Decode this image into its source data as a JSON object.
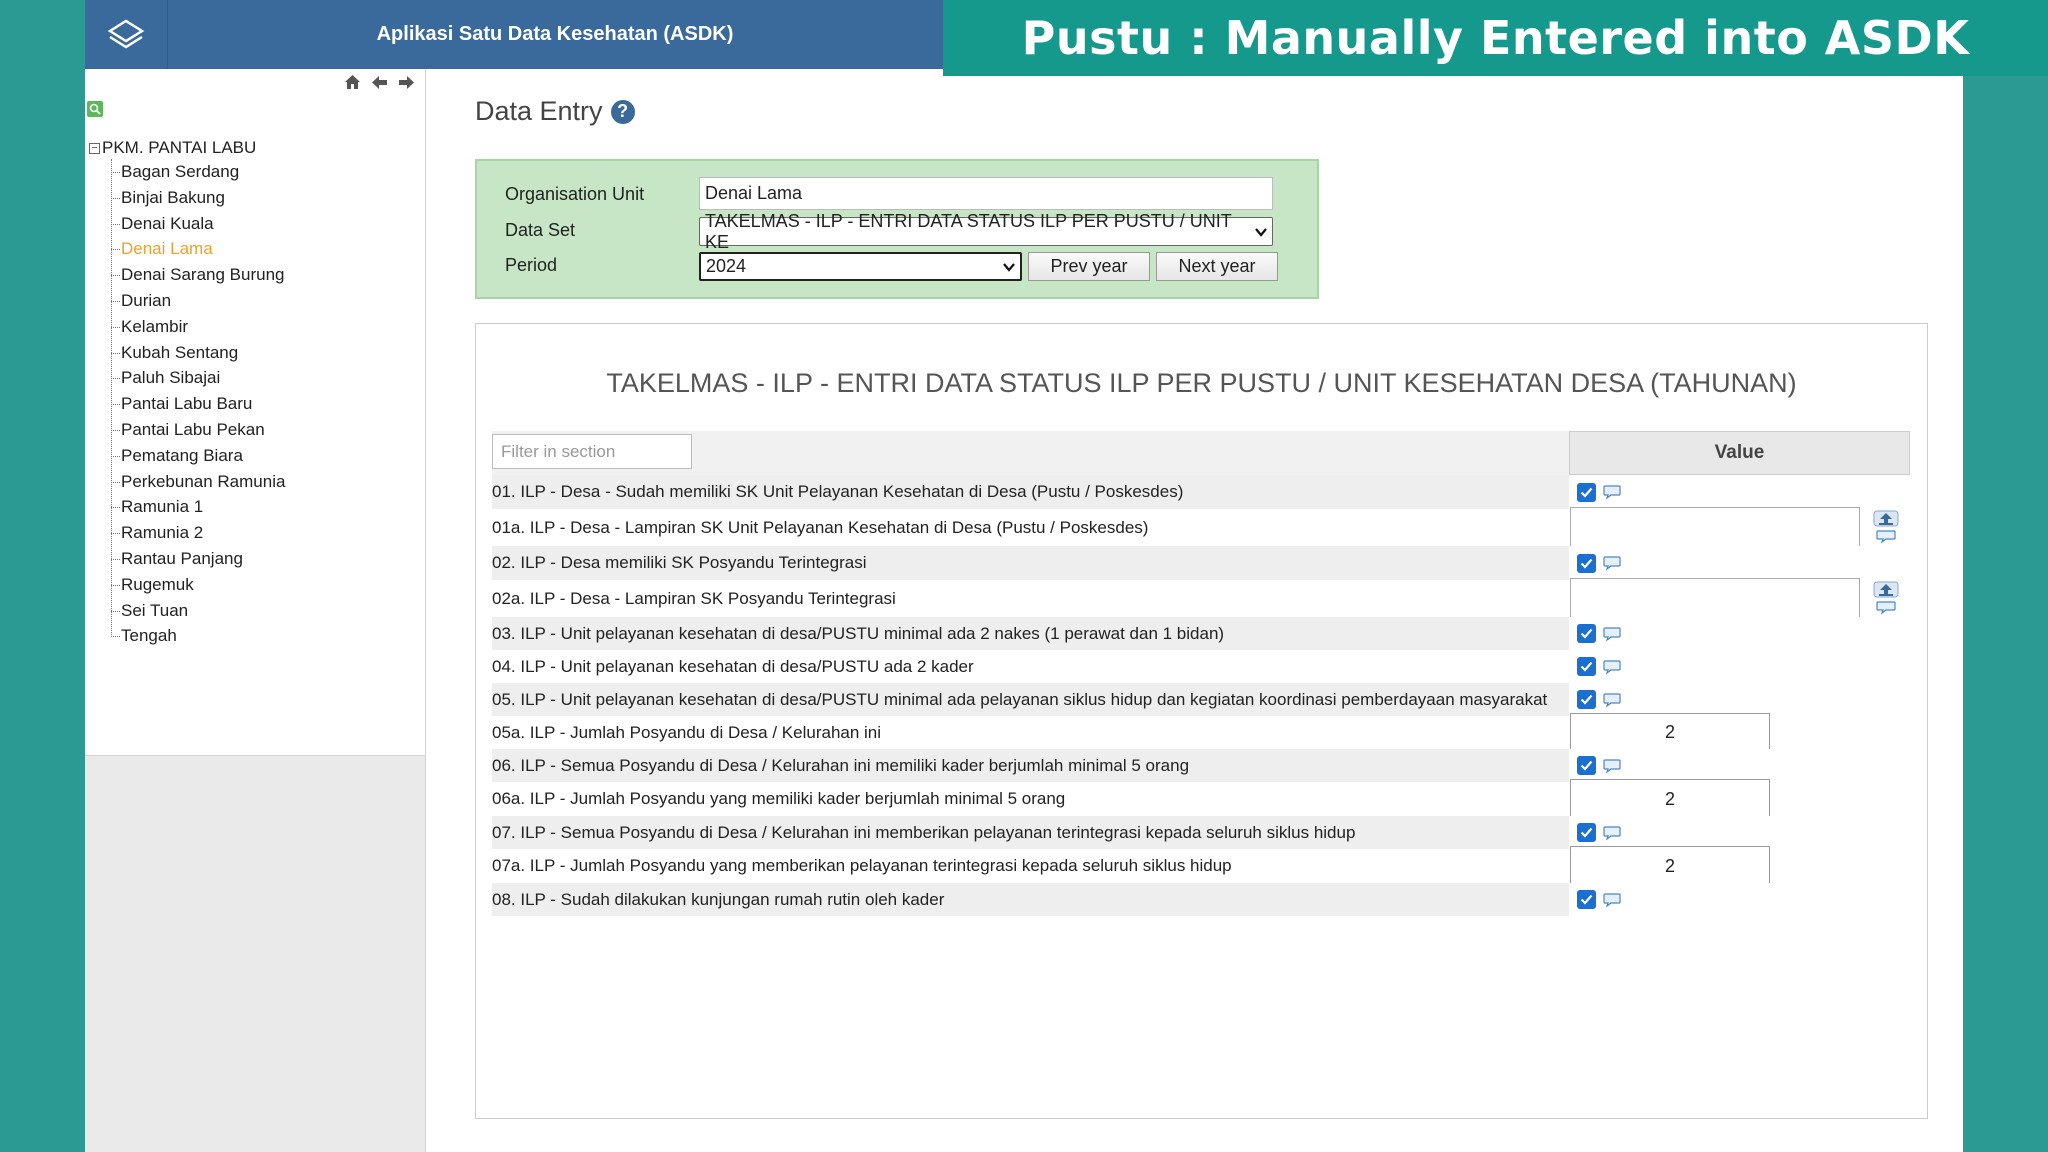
{
  "header": {
    "app_title": "Aplikasi Satu Data Kesehatan (ASDK)",
    "banner": "Pustu : Manually Entered into ASDK"
  },
  "sidebar": {
    "nav_icons": [
      "home-icon",
      "arrow-left-icon",
      "arrow-right-icon"
    ],
    "root": "PKM. PANTAI LABU",
    "items": [
      {
        "label": "Bagan Serdang"
      },
      {
        "label": "Binjai Bakung"
      },
      {
        "label": "Denai Kuala"
      },
      {
        "label": "Denai Lama",
        "selected": true
      },
      {
        "label": "Denai Sarang Burung"
      },
      {
        "label": "Durian"
      },
      {
        "label": "Kelambir"
      },
      {
        "label": "Kubah Sentang"
      },
      {
        "label": "Paluh Sibajai"
      },
      {
        "label": "Pantai Labu Baru"
      },
      {
        "label": "Pantai Labu Pekan"
      },
      {
        "label": "Pematang Biara"
      },
      {
        "label": "Perkebunan Ramunia"
      },
      {
        "label": "Ramunia 1"
      },
      {
        "label": "Ramunia 2"
      },
      {
        "label": "Rantau Panjang"
      },
      {
        "label": "Rugemuk"
      },
      {
        "label": "Sei Tuan"
      },
      {
        "label": "Tengah"
      }
    ]
  },
  "main": {
    "page_title": "Data Entry",
    "form": {
      "org_unit_label": "Organisation Unit",
      "org_unit_value": "Denai Lama",
      "data_set_label": "Data Set",
      "data_set_value": "TAKELMAS - ILP - ENTRI DATA STATUS ILP PER PUSTU / UNIT KE",
      "period_label": "Period",
      "period_value": "2024",
      "prev_year": "Prev year",
      "next_year": "Next year"
    },
    "section": {
      "title": "TAKELMAS - ILP - ENTRI DATA STATUS ILP PER PUSTU / UNIT KESEHATAN DESA (TAHUNAN)",
      "filter_placeholder": "Filter in section",
      "value_header": "Value",
      "rows": [
        {
          "label": "01. ILP - Desa - Sudah memiliki SK Unit Pelayanan Kesehatan di Desa (Pustu / Poskesdes)",
          "type": "checkbox",
          "checked": true
        },
        {
          "label": "01a. ILP - Desa - Lampiran SK Unit Pelayanan Kesehatan di Desa (Pustu / Poskesdes)",
          "type": "file"
        },
        {
          "label": "02. ILP - Desa memiliki SK Posyandu Terintegrasi",
          "type": "checkbox",
          "checked": true
        },
        {
          "label": "02a. ILP - Desa - Lampiran SK Posyandu Terintegrasi",
          "type": "file"
        },
        {
          "label": "03. ILP - Unit pelayanan kesehatan di desa/PUSTU minimal ada 2 nakes (1 perawat dan 1 bidan)",
          "type": "checkbox",
          "checked": true
        },
        {
          "label": "04. ILP - Unit pelayanan kesehatan di desa/PUSTU ada 2 kader",
          "type": "checkbox",
          "checked": true
        },
        {
          "label": "05. ILP - Unit pelayanan kesehatan di desa/PUSTU minimal ada pelayanan siklus hidup dan kegiatan koordinasi pemberdayaan masyarakat",
          "type": "checkbox",
          "checked": true
        },
        {
          "label": "05a. ILP - Jumlah Posyandu di Desa / Kelurahan ini",
          "type": "number",
          "value": "2"
        },
        {
          "label": "06. ILP - Semua Posyandu di Desa / Kelurahan ini memiliki kader berjumlah minimal 5 orang",
          "type": "checkbox",
          "checked": true
        },
        {
          "label": "06a. ILP - Jumlah Posyandu yang memiliki kader berjumlah minimal 5 orang",
          "type": "number",
          "value": "2"
        },
        {
          "label": "07. ILP - Semua Posyandu di Desa / Kelurahan ini memberikan pelayanan terintegrasi kepada seluruh siklus hidup",
          "type": "checkbox",
          "checked": true
        },
        {
          "label": "07a. ILP - Jumlah Posyandu yang memberikan pelayanan terintegrasi kepada seluruh siklus hidup",
          "type": "number",
          "value": "2"
        },
        {
          "label": "08. ILP - Sudah dilakukan kunjungan rumah rutin oleh kader",
          "type": "checkbox",
          "checked": true
        }
      ]
    }
  },
  "colors": {
    "header_bg": "#3a6a9c",
    "banner_bg": "#15998c",
    "page_bg": "#2b9a93",
    "form_bg": "#c7e6c5",
    "selected_item": "#f0a030",
    "checkbox": "#1a6fd0"
  }
}
